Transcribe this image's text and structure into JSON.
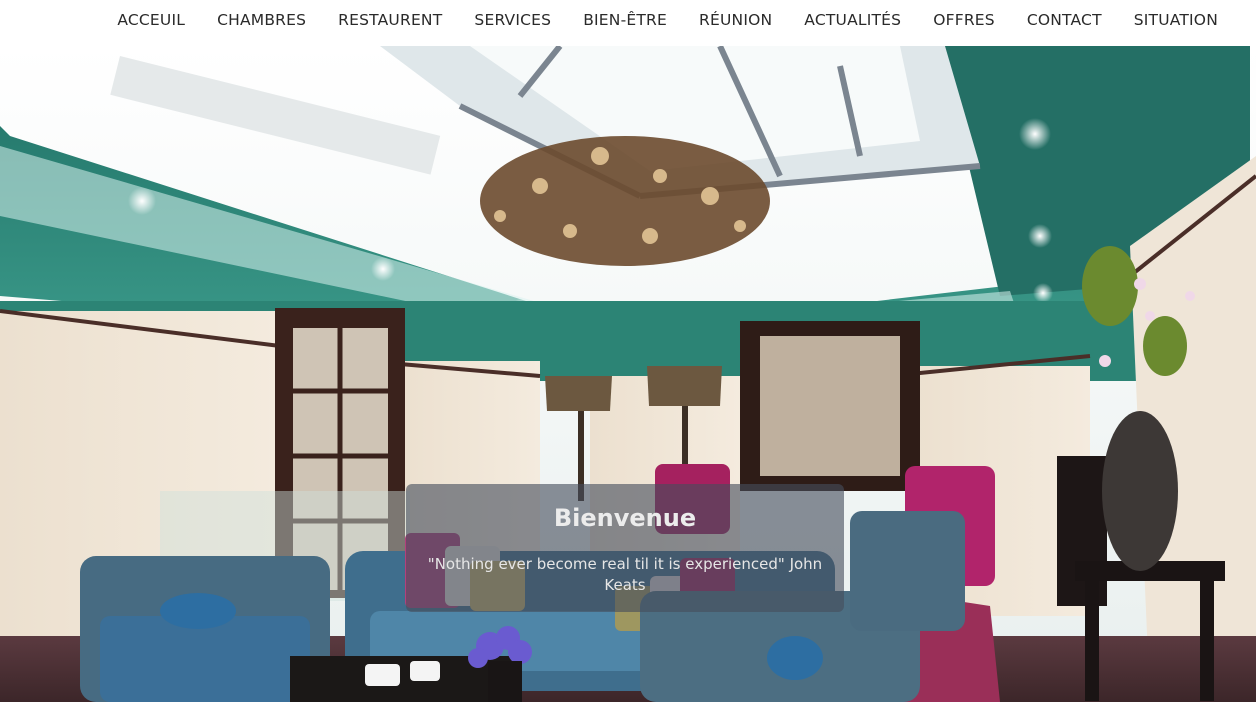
{
  "nav": {
    "items": [
      {
        "label": "ACCEUIL"
      },
      {
        "label": "CHAMBRES"
      },
      {
        "label": "RESTAURENT"
      },
      {
        "label": "SERVICES"
      },
      {
        "label": "BIEN-ÊTRE"
      },
      {
        "label": "RÉUNION"
      },
      {
        "label": "ACTUALITÉS"
      },
      {
        "label": "OFFRES"
      },
      {
        "label": "CONTACT"
      },
      {
        "label": "SITUATION"
      }
    ]
  },
  "hero": {
    "title": "Bienvenue",
    "quote": "\"Nothing ever become real til it is experienced\" John Keats"
  },
  "colors": {
    "wall_green": "#2f8f80",
    "ceiling_white": "#f4f6f6",
    "panel_cream": "#efe3d2",
    "sofa_blue": "#3e6c8e",
    "armchair_magenta": "#b0246a",
    "carpet": "#5a3940"
  }
}
